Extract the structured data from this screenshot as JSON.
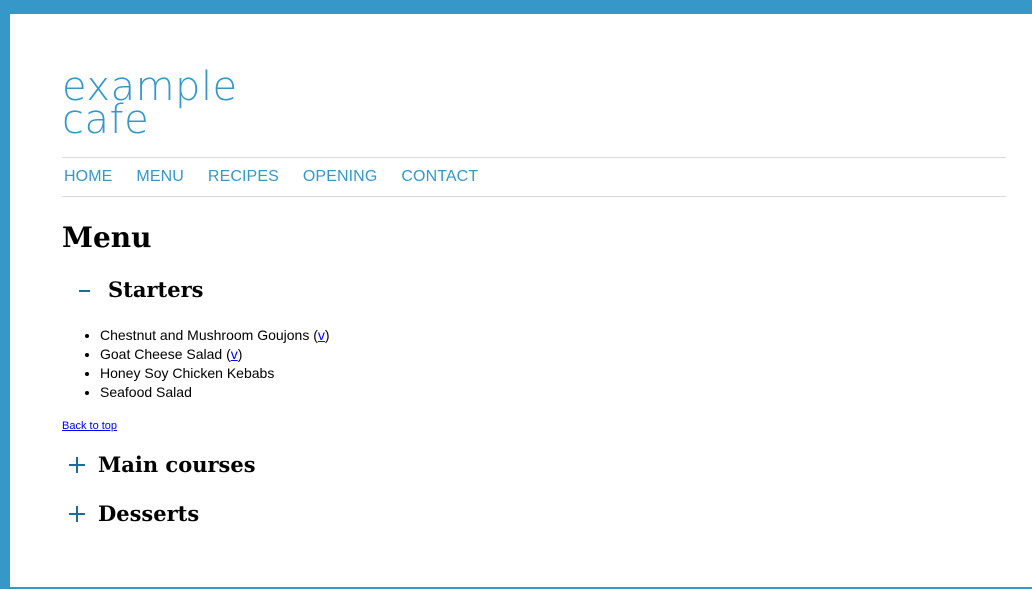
{
  "brand": {
    "line1": "example",
    "line2": "cafe",
    "color": "#3598c9"
  },
  "nav": {
    "items": [
      {
        "label": "HOME"
      },
      {
        "label": "MENU"
      },
      {
        "label": "RECIPES"
      },
      {
        "label": "OPENING"
      },
      {
        "label": "CONTACT"
      }
    ]
  },
  "page_title": "Menu",
  "sections": {
    "starters": {
      "title": "Starters",
      "state": "expanded",
      "items": [
        {
          "name": "Chestnut and Mushroom Goujons",
          "open": " (",
          "veg": "v",
          "close": ")"
        },
        {
          "name": "Goat Cheese Salad",
          "open": " (",
          "veg": "v",
          "close": ")"
        },
        {
          "name": "Honey Soy Chicken Kebabs"
        },
        {
          "name": "Seafood Salad"
        }
      ],
      "back_to_top": "Back to top"
    },
    "main_courses": {
      "title": "Main courses",
      "state": "collapsed"
    },
    "desserts": {
      "title": "Desserts",
      "state": "collapsed"
    }
  },
  "colors": {
    "frame": "#3598c9",
    "toggle": "#1f6d96",
    "link": "#0000ee"
  }
}
